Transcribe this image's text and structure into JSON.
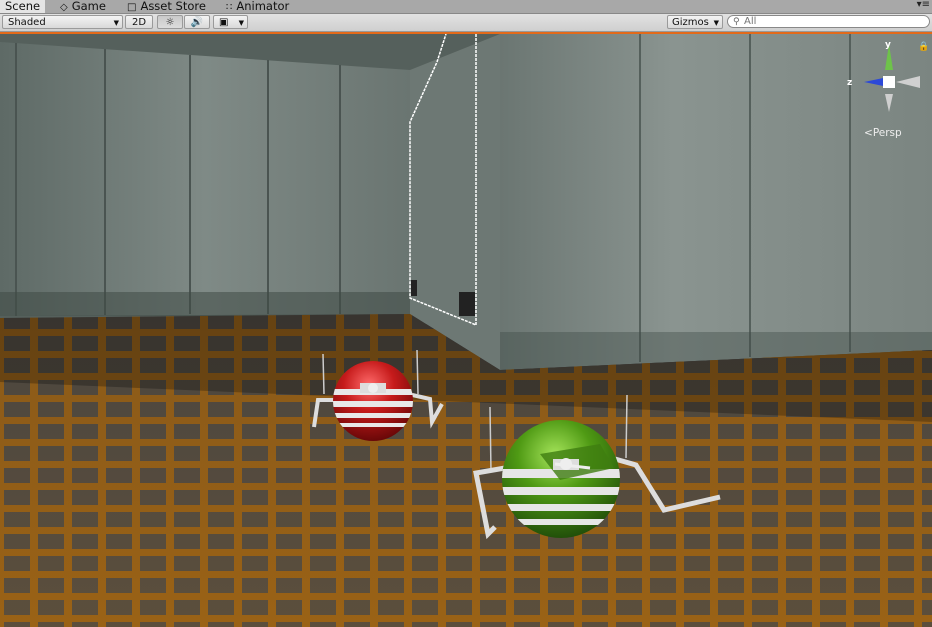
{
  "tabs": [
    {
      "label": "Scene",
      "icon": "scene-icon",
      "active": true
    },
    {
      "label": "Game",
      "icon": "game-icon",
      "active": false
    },
    {
      "label": "Asset Store",
      "icon": "asset-store-icon",
      "active": false
    },
    {
      "label": "Animator",
      "icon": "animator-icon",
      "active": false
    }
  ],
  "toolbar": {
    "shading_mode": "Shaded",
    "mode_2d": "2D",
    "gizmos": "Gizmos",
    "search_placeholder": "All"
  },
  "gizmo": {
    "y_label": "y",
    "z_label": "z",
    "projection": "Persp",
    "colors": {
      "y": "#6ec34a",
      "z": "#2c49d8",
      "x": "#cccccc"
    }
  },
  "scene": {
    "objects": [
      {
        "name": "red-striped-spider-robot",
        "color": "#c61b1b"
      },
      {
        "name": "green-striped-spider-robot",
        "color": "#4f9a14"
      }
    ],
    "floor_color": "#a36315",
    "viewport_border_color": "#e36a1a"
  }
}
